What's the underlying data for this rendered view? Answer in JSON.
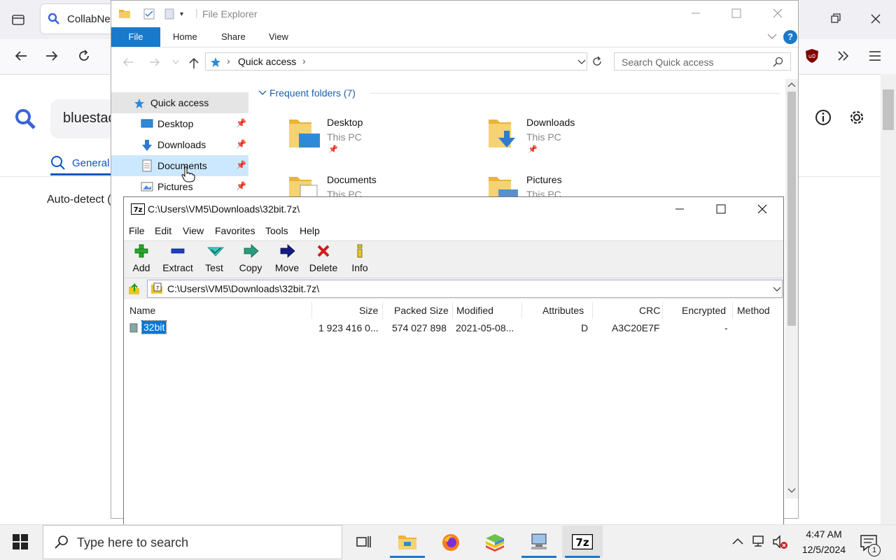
{
  "browser": {
    "tab_title": "CollabNe",
    "search_value": "bluestac",
    "general_tab": "General",
    "autodetect_text": "Auto-detect ("
  },
  "explorer": {
    "title": "File Explorer",
    "ribbon_tabs": [
      "File",
      "Home",
      "Share",
      "View"
    ],
    "help": "?",
    "address": "Quick access",
    "search_placeholder": "Search Quick access",
    "frequent_header": "Frequent folders (7)",
    "nav": {
      "quick_access": "Quick access",
      "items": [
        "Desktop",
        "Downloads",
        "Documents",
        "Pictures"
      ]
    },
    "tiles": [
      {
        "name": "Desktop",
        "sub": "This PC"
      },
      {
        "name": "Downloads",
        "sub": "This PC"
      },
      {
        "name": "Documents",
        "sub": "This PC"
      },
      {
        "name": "Pictures",
        "sub": "This PC"
      }
    ]
  },
  "sevenzip": {
    "title": "C:\\Users\\VM5\\Downloads\\32bit.7z\\",
    "menu": [
      "File",
      "Edit",
      "View",
      "Favorites",
      "Tools",
      "Help"
    ],
    "toolbar": [
      "Add",
      "Extract",
      "Test",
      "Copy",
      "Move",
      "Delete",
      "Info"
    ],
    "path": "C:\\Users\\VM5\\Downloads\\32bit.7z\\",
    "columns": [
      "Name",
      "Size",
      "Packed Size",
      "Modified",
      "Attributes",
      "CRC",
      "Encrypted",
      "Method"
    ],
    "rows": [
      {
        "name": "32bit",
        "size": "1 923 416 0...",
        "packed": "574 027 898",
        "modified": "2021-05-08...",
        "attributes": "D",
        "crc": "A3C20E7F",
        "encrypted": "-",
        "method": ""
      }
    ]
  },
  "taskbar": {
    "search_placeholder": "Type here to search",
    "time": "4:47 AM",
    "date": "12/5/2024",
    "notification_count": "1"
  },
  "colors": {
    "accent": "#1979ca",
    "selection": "#0078d7",
    "nav_hover": "#cce8ff"
  }
}
